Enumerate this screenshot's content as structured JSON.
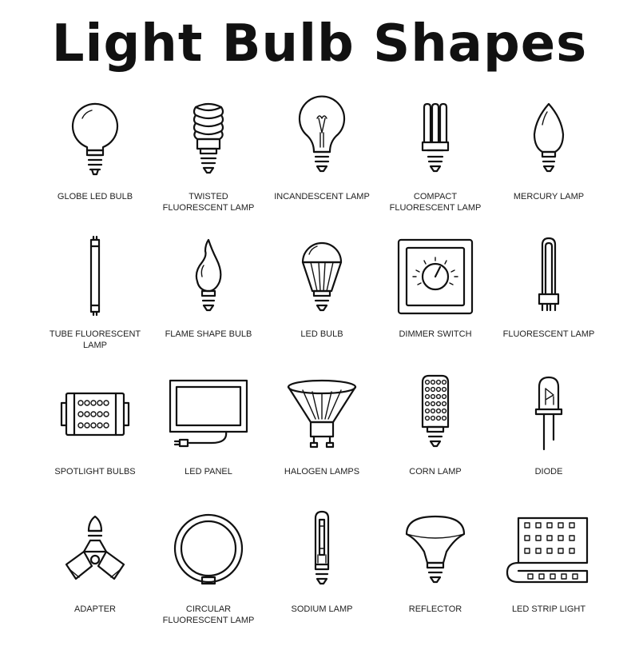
{
  "title": "Light Bulb Shapes",
  "items": [
    {
      "icon": "globe-led-bulb-icon",
      "line1": "GLOBE LED BULB",
      "line2": ""
    },
    {
      "icon": "twisted-fluorescent-lamp-icon",
      "line1": "TWISTED",
      "line2": "FLUORESCENT LAMP"
    },
    {
      "icon": "incandescent-lamp-icon",
      "line1": "INCANDESCENT LAMP",
      "line2": ""
    },
    {
      "icon": "compact-fluorescent-lamp-icon",
      "line1": "COMPACT",
      "line2": "FLUORESCENT LAMP"
    },
    {
      "icon": "mercury-lamp-icon",
      "line1": "MERCURY LAMP",
      "line2": ""
    },
    {
      "icon": "tube-fluorescent-lamp-icon",
      "line1": "TUBE FLUORESCENT",
      "line2": "LAMP"
    },
    {
      "icon": "flame-shape-bulb-icon",
      "line1": "FLAME SHAPE BULB",
      "line2": ""
    },
    {
      "icon": "led-bulb-icon",
      "line1": "LED BULB",
      "line2": ""
    },
    {
      "icon": "dimmer-switch-icon",
      "line1": "DIMMER SWITCH",
      "line2": ""
    },
    {
      "icon": "fluorescent-lamp-icon",
      "line1": "FLUORESCENT LAMP",
      "line2": ""
    },
    {
      "icon": "spotlight-bulbs-icon",
      "line1": "SPOTLIGHT BULBS",
      "line2": ""
    },
    {
      "icon": "led-panel-icon",
      "line1": "LED PANEL",
      "line2": ""
    },
    {
      "icon": "halogen-lamps-icon",
      "line1": "HALOGEN LAMPS",
      "line2": ""
    },
    {
      "icon": "corn-lamp-icon",
      "line1": "CORN LAMP",
      "line2": ""
    },
    {
      "icon": "diode-icon",
      "line1": "DIODE",
      "line2": ""
    },
    {
      "icon": "adapter-icon",
      "line1": "ADAPTER",
      "line2": ""
    },
    {
      "icon": "circular-fluorescent-lamp-icon",
      "line1": "CIRCULAR",
      "line2": "FLUORESCENT LAMP"
    },
    {
      "icon": "sodium-lamp-icon",
      "line1": "SODIUM LAMP",
      "line2": ""
    },
    {
      "icon": "reflector-icon",
      "line1": "REFLECTOR",
      "line2": ""
    },
    {
      "icon": "led-strip-light-icon",
      "line1": "LED STRIP LIGHT",
      "line2": ""
    }
  ]
}
